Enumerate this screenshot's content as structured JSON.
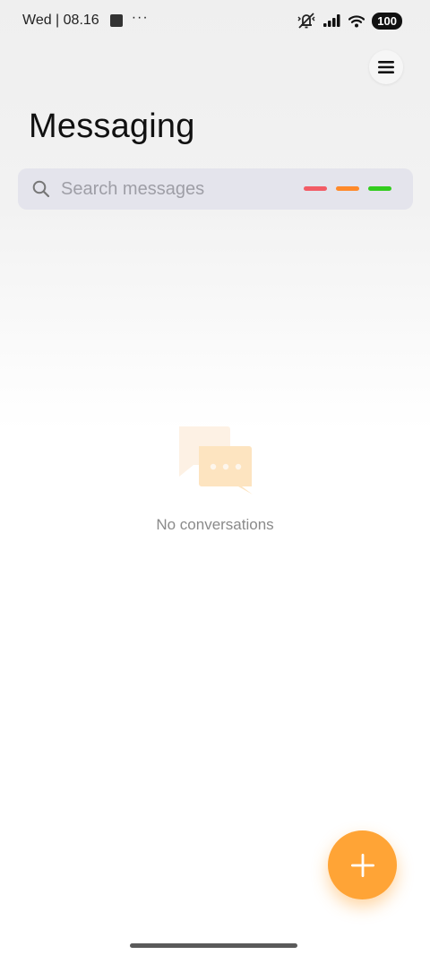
{
  "status_bar": {
    "time": "Wed | 08.16",
    "more_dots": "···",
    "battery": "100",
    "icons": [
      "notification-square-icon",
      "mute-vibrate-icon",
      "signal-icon",
      "wifi-icon",
      "battery-icon"
    ]
  },
  "header": {
    "title": "Messaging",
    "menu_icon": "hamburger-menu-icon"
  },
  "search": {
    "placeholder": "Search messages",
    "value": "",
    "filter_colors": [
      "#f25c66",
      "#ff8a2b",
      "#33cc1f"
    ]
  },
  "empty_state": {
    "text": "No conversations",
    "icon": "chat-bubbles-icon"
  },
  "fab": {
    "icon": "plus-icon",
    "color": "#ffa436"
  }
}
